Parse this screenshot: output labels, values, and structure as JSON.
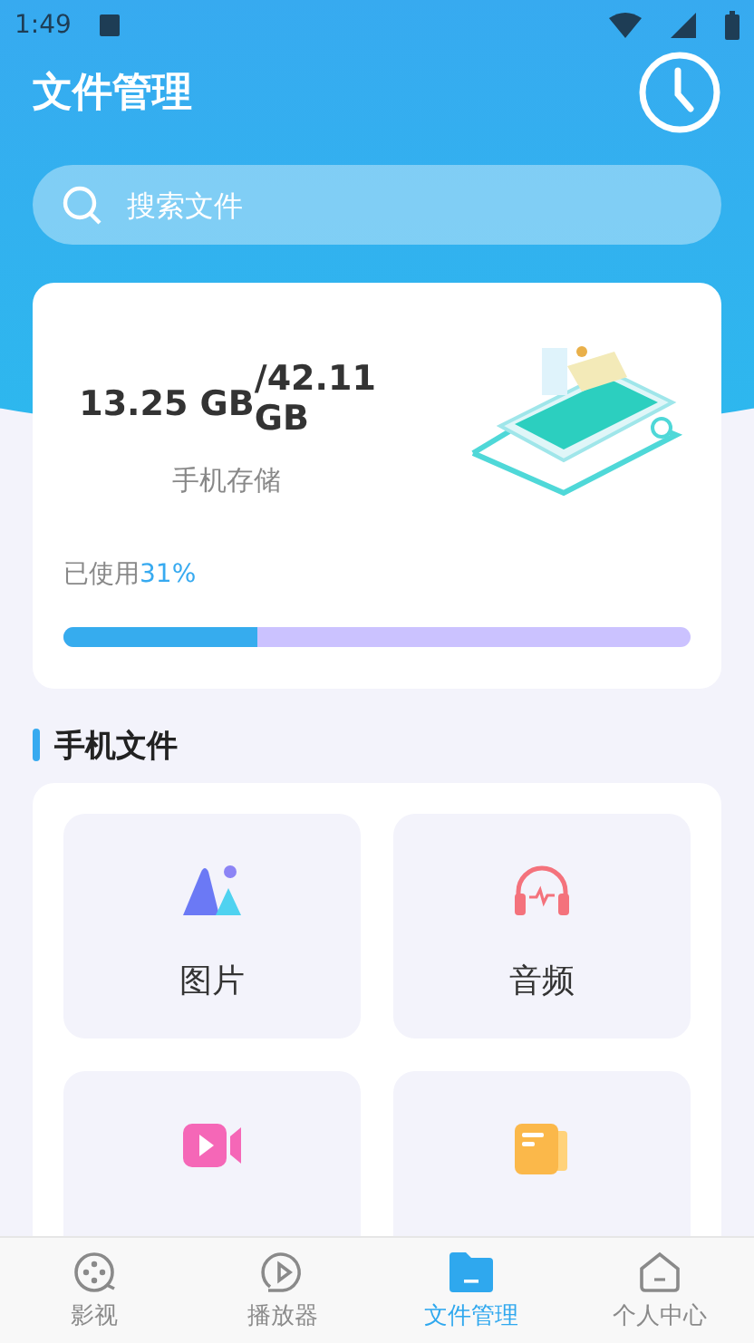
{
  "status_bar": {
    "time": "1:49"
  },
  "header": {
    "title": "文件管理"
  },
  "search": {
    "placeholder": "搜索文件"
  },
  "storage": {
    "used": "13.25 GB",
    "total": "/42.11 GB",
    "label": "手机存储",
    "used_label": "已使用",
    "percent": "31%",
    "level": 0.31
  },
  "section": {
    "title": "手机文件"
  },
  "categories": [
    {
      "kind": "image",
      "label": "图片"
    },
    {
      "kind": "audio",
      "label": "音频"
    },
    {
      "kind": "video"
    },
    {
      "kind": "doc"
    }
  ],
  "nav": [
    {
      "kind": "film",
      "label": "影视",
      "selected": false
    },
    {
      "kind": "player",
      "label": "播放器",
      "selected": false
    },
    {
      "kind": "folder",
      "label": "文件管理",
      "selected": true
    },
    {
      "kind": "home",
      "label": "个人中心",
      "selected": false
    }
  ]
}
